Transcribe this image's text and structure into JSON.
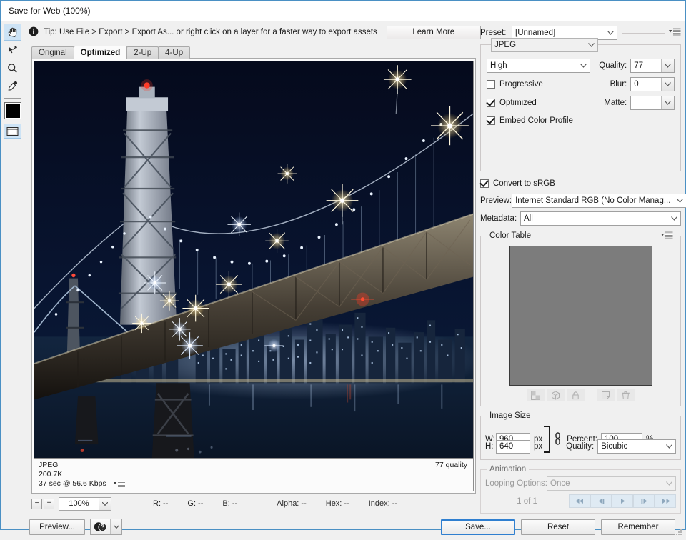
{
  "window": {
    "title": "Save for Web (100%)"
  },
  "tip": {
    "icon": "info-icon",
    "text": "Tip: Use File > Export > Export As...  or right click on a layer for a faster way to export assets",
    "learn_more_label": "Learn More"
  },
  "tools": [
    {
      "name": "hand-tool",
      "selected": true
    },
    {
      "name": "slice-select-tool",
      "selected": false
    },
    {
      "name": "zoom-tool",
      "selected": false
    },
    {
      "name": "eyedropper-tool",
      "selected": false
    }
  ],
  "color_swatch": {
    "name": "eyedropper-color",
    "hex": "#000000"
  },
  "slice_visibility": {
    "name": "toggle-slices-visibility",
    "active": true
  },
  "tabs": [
    {
      "label": "Original",
      "active": false
    },
    {
      "label": "Optimized",
      "active": true
    },
    {
      "label": "2-Up",
      "active": false
    },
    {
      "label": "4-Up",
      "active": false
    }
  ],
  "image_info": {
    "format": "JPEG",
    "file_size": "200.7K",
    "download_time": "37 sec @ 56.6 Kbps",
    "quality_note": "77 quality"
  },
  "status": {
    "zoom_level": "100%",
    "zoom_out_label": "−",
    "zoom_in_label": "+",
    "readouts": [
      "R: --",
      "G: --",
      "B: --"
    ],
    "readouts2": [
      "Alpha: --",
      "Hex: --",
      "Index: --"
    ]
  },
  "preset": {
    "label": "Preset:",
    "value": "[Unnamed]"
  },
  "settings": {
    "format_value": "JPEG",
    "quality_preset_value": "High",
    "quality_label": "Quality:",
    "quality_value": "77",
    "progressive_label": "Progressive",
    "progressive_checked": false,
    "blur_label": "Blur:",
    "blur_value": "0",
    "optimized_label": "Optimized",
    "optimized_checked": true,
    "matte_label": "Matte:",
    "matte_value": "",
    "embed_profile_label": "Embed Color Profile",
    "embed_profile_checked": true
  },
  "color_management": {
    "convert_srgb_label": "Convert to sRGB",
    "convert_srgb_checked": true,
    "preview_label": "Preview:",
    "preview_value": "Internet Standard RGB (No Color Manag...",
    "metadata_label": "Metadata:",
    "metadata_value": "All"
  },
  "color_table": {
    "title": "Color Table",
    "swatch_hex": "#7c7c7c",
    "buttons": [
      {
        "name": "map-to-transparent-button"
      },
      {
        "name": "web-safe-cube-button"
      },
      {
        "name": "lock-color-button"
      },
      {
        "name": "new-color-button"
      },
      {
        "name": "delete-color-button"
      }
    ]
  },
  "image_size": {
    "title": "Image Size",
    "w_label": "W:",
    "w_value": "960",
    "w_unit": "px",
    "h_label": "H:",
    "h_value": "640",
    "h_unit": "px",
    "percent_label": "Percent:",
    "percent_value": "100",
    "percent_unit": "%",
    "quality_label": "Quality:",
    "quality_value": "Bicubic",
    "constrain_linked": true
  },
  "animation": {
    "title": "Animation",
    "looping_label": "Looping Options:",
    "looping_value": "Once",
    "frame_label": "1 of 1",
    "nav_buttons": [
      {
        "name": "first-frame-button"
      },
      {
        "name": "previous-frame-button"
      },
      {
        "name": "play-button"
      },
      {
        "name": "next-frame-button"
      },
      {
        "name": "last-frame-button"
      }
    ]
  },
  "footer": {
    "preview_label": "Preview...",
    "save_label": "Save...",
    "reset_label": "Reset",
    "remember_label": "Remember"
  },
  "photo": {
    "description": "Bay Bridge at night with San Francisco skyline",
    "sky_hex": "#060d22",
    "water_hex": "#0d1a2e"
  }
}
